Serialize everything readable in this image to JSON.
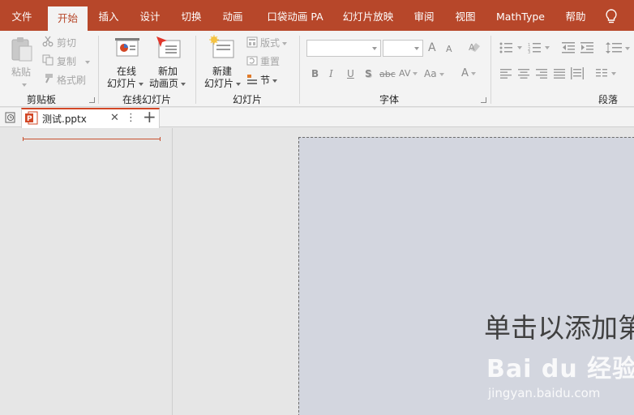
{
  "menu": {
    "tabs": [
      "文件",
      "开始",
      "插入",
      "设计",
      "切换",
      "动画",
      "口袋动画 PA",
      "幻灯片放映",
      "审阅",
      "视图",
      "MathType",
      "帮助"
    ],
    "active": "开始"
  },
  "ribbon": {
    "clipboard": {
      "paste": "粘贴",
      "cut": "剪切",
      "copy": "复制",
      "format_painter": "格式刷",
      "label": "剪贴板"
    },
    "online": {
      "online_slide_line1": "在线",
      "online_slide_line2": "幻灯片",
      "new_anim_line1": "新加",
      "new_anim_line2": "动画页",
      "label": "在线幻灯片"
    },
    "slides": {
      "new_slide_line1": "新建",
      "new_slide_line2": "幻灯片",
      "layout": "版式",
      "reset": "重置",
      "section": "节",
      "label": "幻灯片"
    },
    "font": {
      "label": "字体",
      "font_name": "",
      "font_size": "",
      "bold": "B",
      "italic": "I",
      "underline": "U",
      "shadow": "S",
      "strike": "abc",
      "spacing": "AV",
      "change_case": "Aa",
      "grow": "A",
      "shrink": "A",
      "color": "A"
    },
    "paragraph": {
      "label": "段落"
    }
  },
  "doc_tab": {
    "filename": "测试.pptx",
    "close": "✕",
    "more": "⋮",
    "add": "+"
  },
  "slide": {
    "title_placeholder": "单击以添加第"
  },
  "watermark": {
    "logo": "Bai du 经验",
    "url": "jingyan.baidu.com"
  },
  "colors": {
    "accent": "#b7472a",
    "ribbon_bg": "#f3f3f3",
    "workspace_bg": "#e6e6e6",
    "slide_bg": "#d3d6df"
  }
}
